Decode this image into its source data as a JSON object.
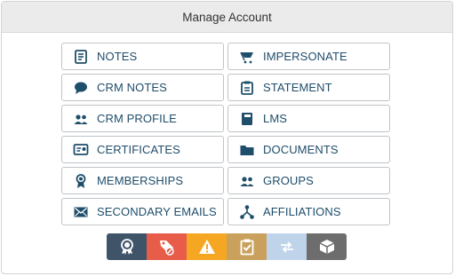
{
  "header": {
    "title": "Manage Account"
  },
  "buttons": [
    {
      "label": "NOTES",
      "icon": "notes-icon"
    },
    {
      "label": "IMPERSONATE",
      "icon": "impersonate-icon"
    },
    {
      "label": "CRM NOTES",
      "icon": "chat-bubble-icon"
    },
    {
      "label": "STATEMENT",
      "icon": "statement-icon"
    },
    {
      "label": "CRM PROFILE",
      "icon": "users-icon"
    },
    {
      "label": "LMS",
      "icon": "book-icon"
    },
    {
      "label": "CERTIFICATES",
      "icon": "certificate-icon"
    },
    {
      "label": "DOCUMENTS",
      "icon": "folder-icon"
    },
    {
      "label": "MEMBERSHIPS",
      "icon": "award-ribbon-icon"
    },
    {
      "label": "GROUPS",
      "icon": "group-icon"
    },
    {
      "label": "SECONDARY EMAILS",
      "icon": "envelope-icon"
    },
    {
      "label": "AFFILIATIONS",
      "icon": "affiliations-icon"
    }
  ],
  "colors": {
    "text": "#1f4e6b",
    "strip": [
      "#3f5469",
      "#e85c4a",
      "#f5a623",
      "#c9a15d",
      "#bfd4ea",
      "#6d6d6d"
    ]
  },
  "strip_icons": [
    "badge-icon",
    "tag-icon",
    "warning-icon",
    "clipboard-check-icon",
    "transfer-icon",
    "box-icon"
  ]
}
